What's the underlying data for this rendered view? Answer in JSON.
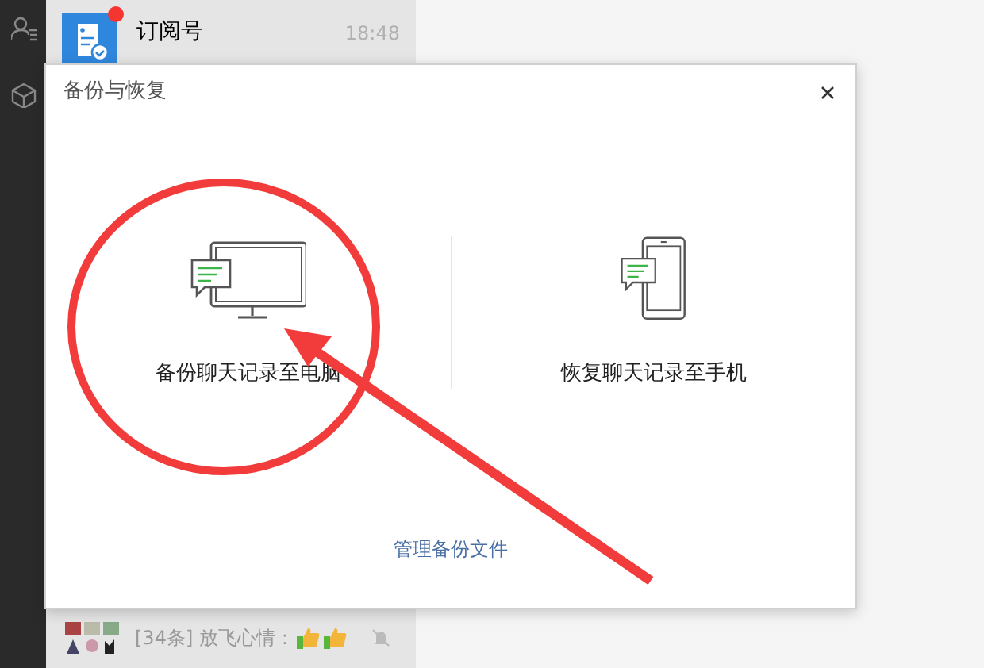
{
  "chat_list": [
    {
      "kind": "subscription",
      "title": "订阅号",
      "time": "18:48",
      "unread": true
    },
    {
      "kind": "group",
      "preview": "[34条] 放飞心情：",
      "muted": true
    }
  ],
  "dialog": {
    "title": "备份与恢复",
    "options": [
      {
        "kind": "computer",
        "label": "备份聊天记录至电脑"
      },
      {
        "kind": "phone",
        "label": "恢复聊天记录至手机"
      }
    ],
    "link": "管理备份文件"
  }
}
